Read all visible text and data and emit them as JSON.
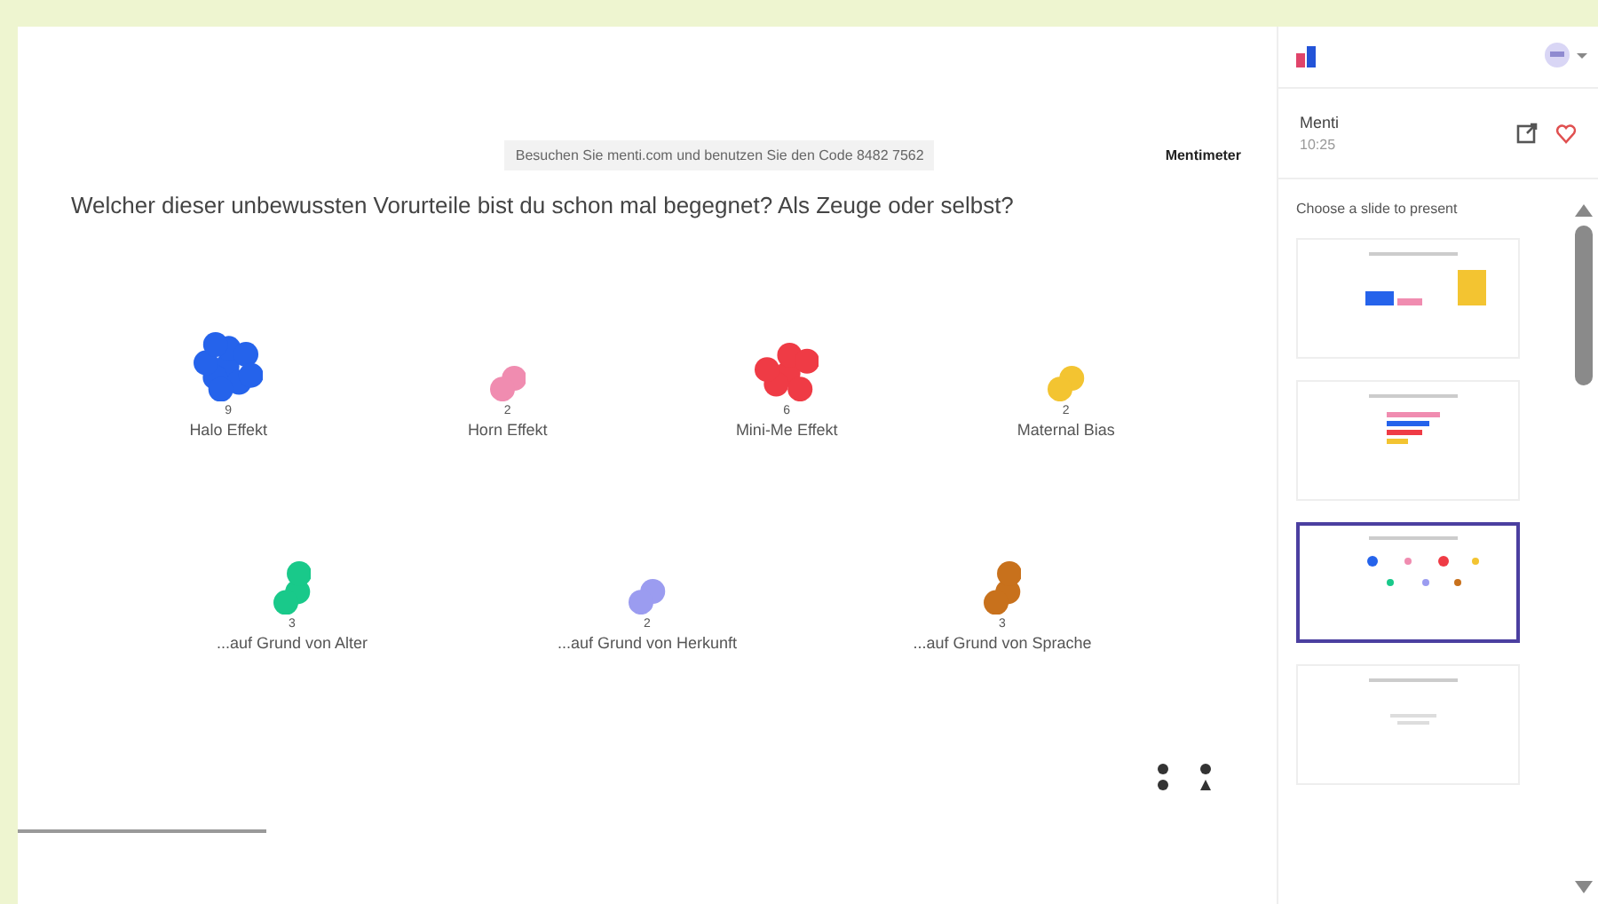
{
  "slide": {
    "join_banner": "Besuchen Sie menti.com und benutzen Sie den Code  8482 7562",
    "logo": "Mentimeter",
    "question": "Welcher dieser unbewussten Vorurteile bist du schon mal begegnet? Als Zeuge oder selbst?",
    "bubbles": [
      {
        "label": "Halo Effekt",
        "count": "9",
        "color": "#2563eb"
      },
      {
        "label": "Horn Effekt",
        "count": "2",
        "color": "#f08cb0"
      },
      {
        "label": "Mini-Me Effekt",
        "count": "6",
        "color": "#ef3b45"
      },
      {
        "label": "Maternal Bias",
        "count": "2",
        "color": "#f3c431"
      },
      {
        "label": "...auf Grund von Alter",
        "count": "3",
        "color": "#19c98a"
      },
      {
        "label": "...auf Grund von Herkunft",
        "count": "2",
        "color": "#9b9cf0"
      },
      {
        "label": "...auf Grund von Sprache",
        "count": "3",
        "color": "#c8711c"
      }
    ]
  },
  "sidebar": {
    "presentation": "Menti",
    "time": "10:25",
    "prompt": "Choose a slide to present",
    "slides": [
      {
        "kind": "bars",
        "selected": false
      },
      {
        "kind": "hbars",
        "selected": false
      },
      {
        "kind": "bubbles",
        "selected": true
      },
      {
        "kind": "cloud",
        "selected": false
      }
    ]
  }
}
